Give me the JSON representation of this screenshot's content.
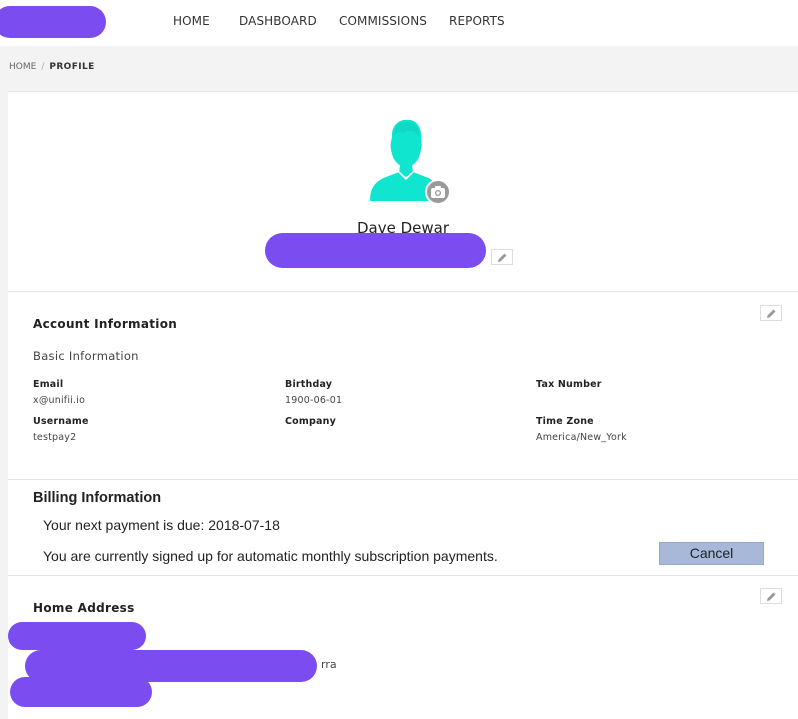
{
  "nav": {
    "items": [
      "HOME",
      "DASHBOARD",
      "COMMISSIONS",
      "REPORTS"
    ]
  },
  "breadcrumb": {
    "home": "HOME",
    "separator": "/",
    "current": "PROFILE"
  },
  "profile": {
    "name": "Dave Dewar",
    "avatar_color": "#10e5cf",
    "icons": [
      "user-avatar-icon",
      "camera-icon",
      "pencil-icon"
    ]
  },
  "account": {
    "title": "Account Information",
    "subtitle": "Basic Information",
    "fields": {
      "email_label": "Email",
      "email_value": "x@unifii.io",
      "birthday_label": "Birthday",
      "birthday_value": "1900-06-01",
      "tax_label": "Tax Number",
      "tax_value": "",
      "username_label": "Username",
      "username_value": "testpay2",
      "company_label": "Company",
      "company_value": "",
      "timezone_label": "Time Zone",
      "timezone_value": "America/New_York"
    }
  },
  "billing": {
    "title": "Billing Information",
    "next_payment": "Your next payment is due: 2018-07-18",
    "subscription": "You are currently signed up for automatic monthly subscription payments.",
    "cancel_label": "Cancel"
  },
  "address": {
    "title": "Home Address",
    "visible_fragment": "rra"
  },
  "colors": {
    "redaction": "#7b4cf0",
    "cancel_button": "#a7b8d9",
    "page_background": "#f3f3f3"
  }
}
